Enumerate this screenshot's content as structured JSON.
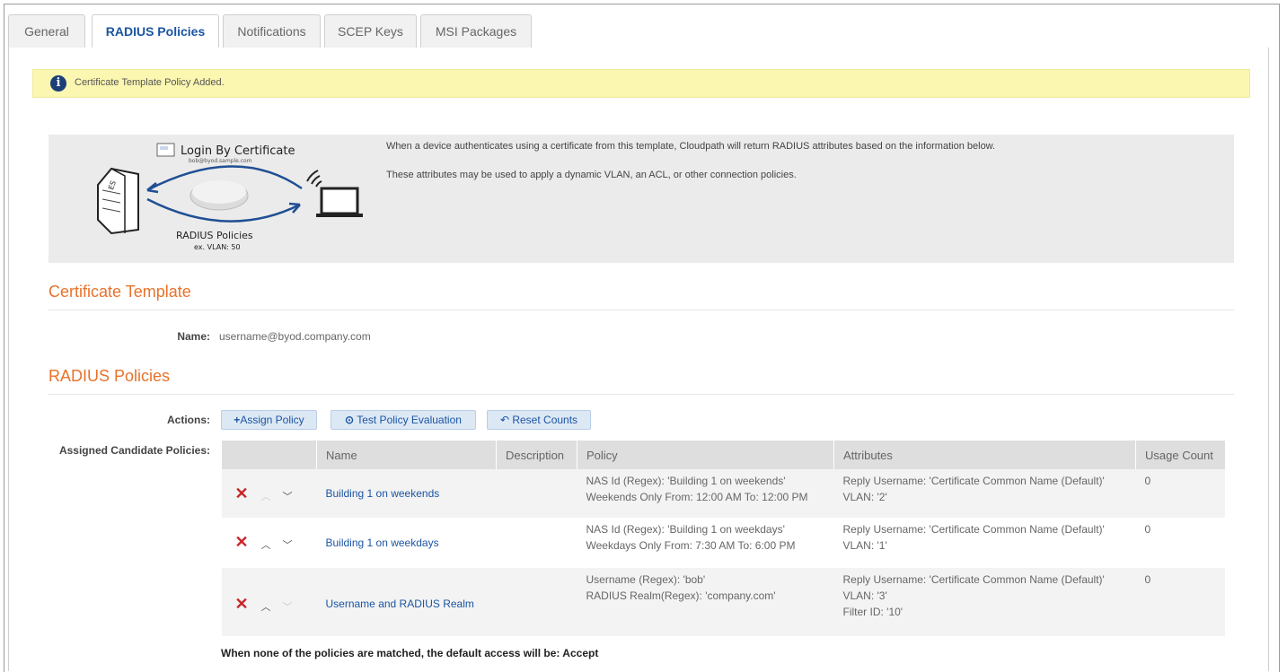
{
  "tabs": [
    {
      "label": "General",
      "active": false
    },
    {
      "label": "RADIUS Policies",
      "active": true
    },
    {
      "label": "Notifications",
      "active": false
    },
    {
      "label": "SCEP Keys",
      "active": false
    },
    {
      "label": "MSI Packages",
      "active": false
    }
  ],
  "alert": {
    "icon": "info-icon",
    "message": "Certificate Template Policy Added."
  },
  "diagram": {
    "login_title": "Login By Certificate",
    "login_user": "bob@byod.sample.com",
    "radius_title": "RADIUS Policies",
    "radius_example": "ex. VLAN: 50",
    "server_badge": "ES"
  },
  "info": {
    "line1": "When a device authenticates using a certificate from this template, Cloudpath will return RADIUS attributes based on the information below.",
    "line2": "These attributes may be used to apply a dynamic VLAN, an ACL, or other connection policies."
  },
  "certificate_template": {
    "heading": "Certificate Template",
    "name_label": "Name:",
    "name_value": "username@byod.company.com"
  },
  "radius_policies": {
    "heading": "RADIUS Policies",
    "actions_label": "Actions:",
    "buttons": {
      "assign": "Assign Policy",
      "test": "Test Policy Evaluation",
      "reset": "Reset Counts"
    },
    "assigned_label": "Assigned Candidate Policies:",
    "columns": [
      "Name",
      "Description",
      "Policy",
      "Attributes",
      "Usage Count"
    ],
    "rows": [
      {
        "name": "Building 1 on weekends",
        "description": "",
        "policy": [
          "NAS Id (Regex): 'Building 1 on weekends'",
          "Weekends Only From: 12:00 AM To: 12:00 PM"
        ],
        "attributes": [
          "Reply Username: 'Certificate Common Name (Default)'",
          "VLAN: '2'"
        ],
        "usage_count": "0"
      },
      {
        "name": "Building 1 on weekdays",
        "description": "",
        "policy": [
          "NAS Id (Regex): 'Building 1 on weekdays'",
          "Weekdays Only From: 7:30 AM To: 6:00 PM"
        ],
        "attributes": [
          "Reply Username: 'Certificate Common Name (Default)'",
          "VLAN: '1'"
        ],
        "usage_count": "0"
      },
      {
        "name": "Username and RADIUS Realm",
        "description": "",
        "policy": [
          "Username (Regex): 'bob'",
          "RADIUS Realm(Regex): 'company.com'"
        ],
        "attributes": [
          "Reply Username: 'Certificate Common Name (Default)'",
          "VLAN: '3'",
          "Filter ID: '10'"
        ],
        "usage_count": "0"
      }
    ],
    "default_access_text": "When none of the policies are matched, the default access will be: Accept"
  },
  "colors": {
    "accent_orange": "#e8722a",
    "link_blue": "#1b55a3",
    "alert_yellow": "#fbf7b0",
    "delete_red": "#c8272b"
  }
}
